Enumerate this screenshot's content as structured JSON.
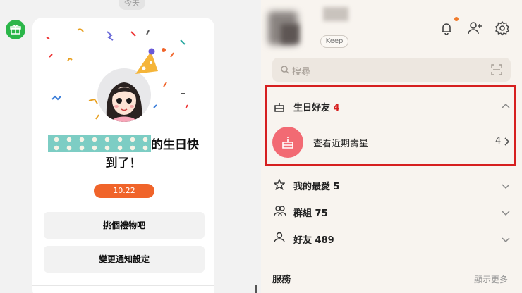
{
  "chat": {
    "date_label": "今天",
    "birthday_message_suffix": "的生日快",
    "birthday_message_line2": "到了！",
    "birthday_date": "10.22",
    "buttons": {
      "gift": "挑個禮物吧",
      "notification_settings": "變更通知設定"
    }
  },
  "friends_panel": {
    "keep_label": "Keep",
    "search_placeholder": "搜尋",
    "sections": {
      "birthday": {
        "label": "生日好友",
        "count": "4"
      },
      "birthday_item": {
        "label": "查看近期壽星",
        "count": "4"
      },
      "favorites": {
        "label": "我的最愛 5"
      },
      "groups": {
        "label": "群組 75"
      },
      "friends": {
        "label": "好友 489"
      }
    },
    "services_label": "服務",
    "show_more_label": "顯示更多"
  },
  "colors": {
    "accent_orange": "#f0642a",
    "birthday_red": "#d61f1f",
    "birthday_icon_bg": "#f26a73",
    "line_green": "#2bb649"
  },
  "icons": [
    "gift-icon",
    "bell-icon",
    "add-friend-icon",
    "settings-icon",
    "search-icon",
    "scan-icon",
    "birthday-cake-icon",
    "star-icon",
    "group-icon",
    "person-icon",
    "chevron-up-icon",
    "chevron-down-icon",
    "chevron-right-icon"
  ]
}
